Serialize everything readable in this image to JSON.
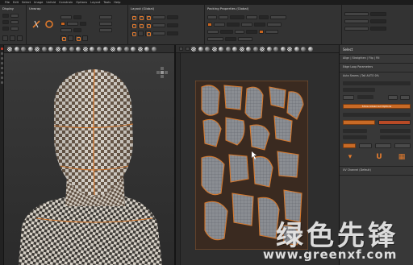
{
  "menubar": {
    "items": [
      "File",
      "Edit",
      "Select",
      "Image",
      "Unfold",
      "Constrain",
      "Options",
      "Layout",
      "Tools",
      "Help"
    ]
  },
  "toolbar": {
    "sections": [
      {
        "title": "Display"
      },
      {
        "title": "Unwrap"
      },
      {
        "title": "Layout (Global)"
      },
      {
        "title": "Packing Properties (Global)"
      }
    ]
  },
  "right_panel": {
    "title": "Select",
    "section_edge_smart": "Align | Straighten | Flip | Fill",
    "section_edge_loop": "Edge Loop Parameters",
    "section_auto_seams": "Auto Seams | Tall AUTO 0%",
    "show_advanced": "Show Advanced Options",
    "uv_channel": "UV Channel (Default)"
  },
  "colors": {
    "accent": "#e07a2c",
    "panel_bg": "#383838",
    "toolbar_bg": "#333333"
  },
  "watermark": {
    "chinese": "绿色先锋",
    "url": "www.greenxf.com"
  }
}
